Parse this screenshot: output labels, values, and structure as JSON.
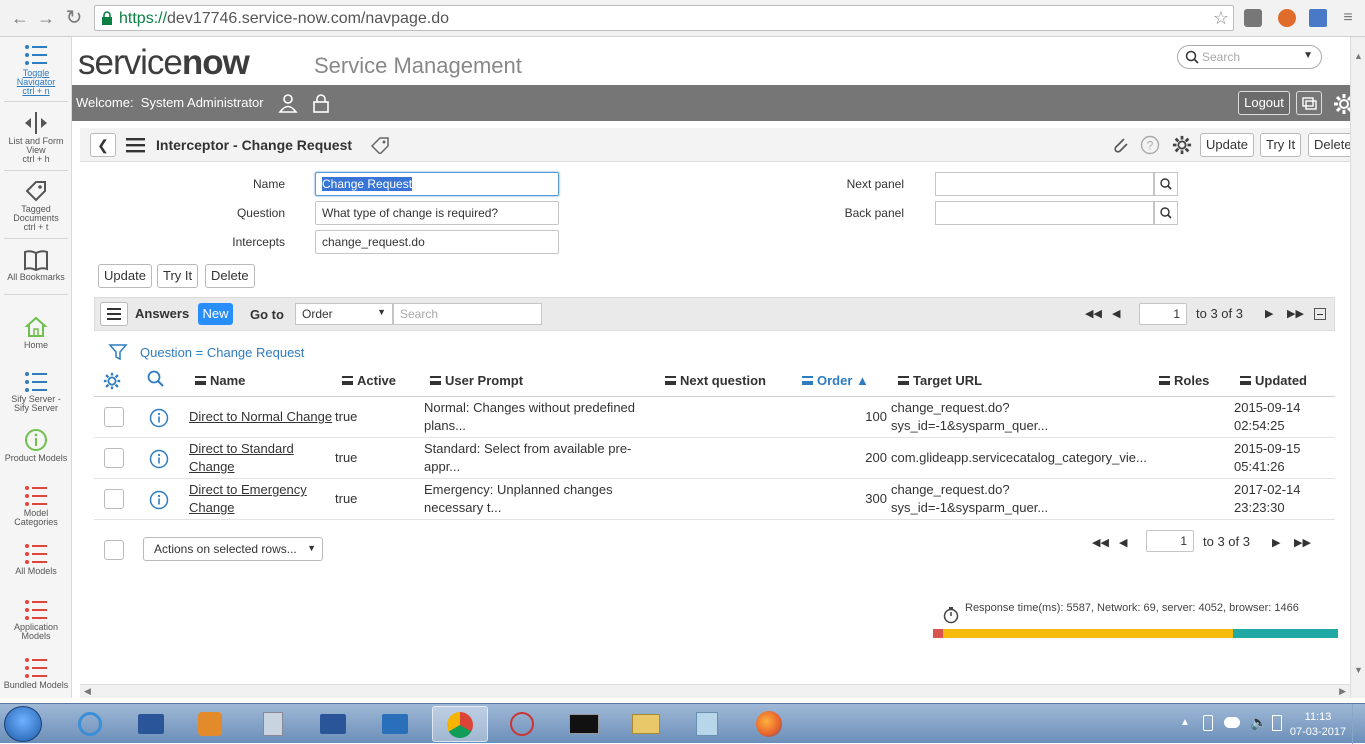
{
  "browser": {
    "url_scheme": "https://",
    "url_rest": "dev17746.service-now.com/navpage.do"
  },
  "left_nav": {
    "items": [
      {
        "label1": "Toggle",
        "label2": "Navigator",
        "shortcut": "ctrl + n"
      },
      {
        "label1": "List and Form",
        "label2": "View",
        "shortcut": "ctrl + h"
      },
      {
        "label1": "Tagged",
        "label2": "Documents",
        "shortcut": "ctrl + t"
      },
      {
        "label1": "All Bookmarks"
      },
      {
        "label1": "Home"
      },
      {
        "label1": "Sify Server -",
        "label2": "Sify Server"
      },
      {
        "label1": "Product Models"
      },
      {
        "label1": "Model",
        "label2": "Categories"
      },
      {
        "label1": "All Models"
      },
      {
        "label1": "Application",
        "label2": "Models"
      },
      {
        "label1": "Bundled Models"
      }
    ]
  },
  "header": {
    "logo_service": "service",
    "logo_now": "now",
    "app_title": "Service Management",
    "search_placeholder": "Search"
  },
  "welcome_bar": {
    "welcome_label": "Welcome:",
    "user": "System Administrator",
    "logout": "Logout"
  },
  "form": {
    "title": "Interceptor - Change Request",
    "header_buttons": {
      "update": "Update",
      "try_it": "Try It",
      "delete": "Delete"
    },
    "fields": {
      "name_label": "Name",
      "name_value": "Change Request",
      "question_label": "Question",
      "question_value": "What type of change is required?",
      "intercepts_label": "Intercepts",
      "intercepts_value": "change_request.do",
      "next_panel_label": "Next panel",
      "back_panel_label": "Back panel"
    },
    "buttons": {
      "update": "Update",
      "try_it": "Try It",
      "delete": "Delete"
    }
  },
  "list": {
    "title": "Answers",
    "new_label": "New",
    "goto_label": "Go to",
    "goto_field": "Order",
    "search_placeholder": "Search",
    "page_value": "1",
    "page_text": "to 3 of 3",
    "filter": "Question = Change Request",
    "columns": [
      "Name",
      "Active",
      "User Prompt",
      "Next question",
      "Order",
      "Target URL",
      "Roles",
      "Updated"
    ],
    "rows": [
      {
        "name": [
          "Direct to Normal Change",
          ""
        ],
        "active": "true",
        "prompt": [
          "Normal: Changes without predefined",
          "plans..."
        ],
        "next_question": "",
        "order": "100",
        "url": [
          "change_request.do?",
          "sys_id=-1&sysparm_quer..."
        ],
        "updated": [
          "2015-09-14",
          "02:54:25"
        ]
      },
      {
        "name": [
          "Direct to Standard",
          "Change"
        ],
        "active": "true",
        "prompt": [
          "Standard: Select from available pre-",
          "appr..."
        ],
        "next_question": "",
        "order": "200",
        "url": [
          "com.glideapp.servicecatalog_category_vie...",
          ""
        ],
        "updated": [
          "2015-09-15",
          "05:41:26"
        ]
      },
      {
        "name": [
          "Direct to Emergency",
          "Change"
        ],
        "active": "true",
        "prompt": [
          "Emergency: Unplanned changes",
          "necessary t..."
        ],
        "next_question": "",
        "order": "300",
        "url": [
          "change_request.do?",
          "sys_id=-1&sysparm_quer..."
        ],
        "updated": [
          "2017-02-14",
          "23:23:30"
        ]
      }
    ],
    "actions_label": "Actions on selected rows..."
  },
  "response": {
    "text": "Response time(ms): 5587, Network: 69, server: 4052, browser: 1466",
    "network_ms": 69,
    "server_ms": 4052,
    "browser_ms": 1466
  },
  "taskbar": {
    "time": "11:13",
    "date": "07-03-2017"
  },
  "colors": {
    "accent": "#278efc",
    "gray_bar": "#767676",
    "bar_network": "#d9534f",
    "bar_server": "#f7bb0d",
    "bar_browser": "#1fa9a4"
  }
}
